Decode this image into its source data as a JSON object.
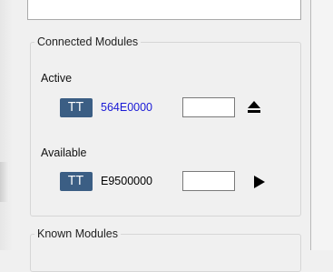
{
  "connected_modules": {
    "title": "Connected Modules",
    "active": {
      "label": "Active",
      "module": {
        "badge": "TT",
        "id": "564E0000",
        "id_color": "#1a1ad6",
        "input_value": "",
        "action_icon": "eject-icon"
      }
    },
    "available": {
      "label": "Available",
      "module": {
        "badge": "TT",
        "id": "E9500000",
        "id_color": "#000000",
        "input_value": "",
        "action_icon": "play-icon"
      }
    }
  },
  "known_modules": {
    "title": "Known Modules"
  },
  "colors": {
    "badge_bg": "#3b5e84",
    "badge_text": "#ffffff"
  }
}
